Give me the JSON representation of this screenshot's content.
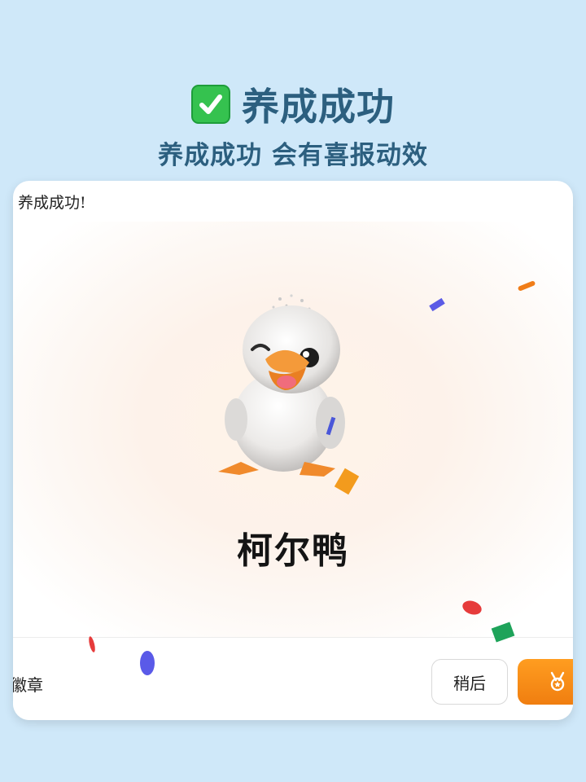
{
  "header": {
    "title": "养成成功",
    "subtitle": "养成成功 会有喜报动效",
    "check_icon": "check-mark-button-icon"
  },
  "dialog": {
    "title": "养成成功!",
    "mascot": {
      "name": "柯尔鸭",
      "image": "white-duckling-illustration"
    },
    "footer": {
      "badge_link": "徽章",
      "later_label": "稍后",
      "primary_icon": "medal-icon"
    }
  },
  "colors": {
    "page_background": "#cfe8f9",
    "heading": "#2c5f7f",
    "primary_button": "#f7901a",
    "check_icon": "#35c24f"
  }
}
